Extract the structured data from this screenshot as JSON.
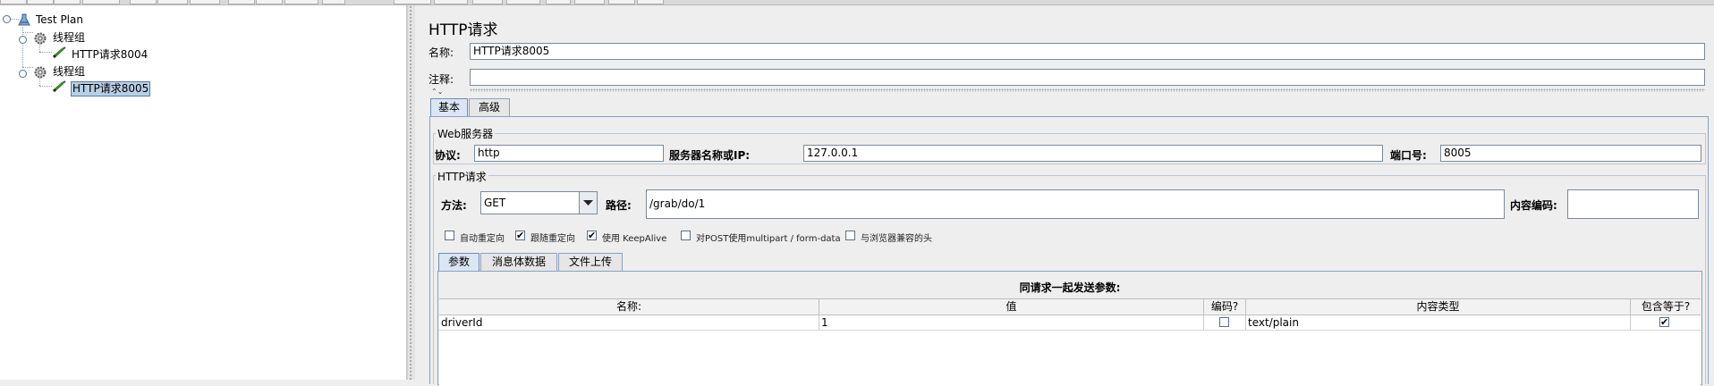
{
  "tree": {
    "items": [
      {
        "label": "Test Plan",
        "icon": "test-plan-icon"
      },
      {
        "label": "线程组",
        "icon": "thread-group-gear-icon"
      },
      {
        "label": "HTTP请求8004",
        "icon": "sampler-pipette-icon"
      },
      {
        "label": "线程组",
        "icon": "thread-group-gear-icon"
      },
      {
        "label": "HTTP请求8005",
        "icon": "sampler-pipette-icon",
        "selected": true
      }
    ]
  },
  "panel": {
    "title": "HTTP请求",
    "name_label": "名称:",
    "name_value": "HTTP请求8005",
    "comment_label": "注释:",
    "comment_value": ""
  },
  "tabs": {
    "basic": "基本",
    "advanced": "高级"
  },
  "web_server": {
    "group_title": "Web服务器",
    "protocol_label": "协议:",
    "protocol_value": "http",
    "server_label": "服务器名称或IP:",
    "server_value": "127.0.0.1",
    "port_label": "端口号:",
    "port_value": "8005"
  },
  "http_request": {
    "group_title": "HTTP请求",
    "method_label": "方法:",
    "method_value": "GET",
    "path_label": "路径:",
    "path_value": "/grab/do/1",
    "encoding_label": "内容编码:",
    "encoding_value": ""
  },
  "options": [
    {
      "label": "自动重定向",
      "checked": false
    },
    {
      "label": "跟随重定向",
      "checked": true
    },
    {
      "label": "使用 KeepAlive",
      "checked": true
    },
    {
      "label": "对POST使用multipart / form-data",
      "checked": false
    },
    {
      "label": "与浏览器兼容的头",
      "checked": false
    }
  ],
  "sub_tabs": {
    "params": "参数",
    "body": "消息体数据",
    "files": "文件上传"
  },
  "params_table": {
    "caption": "同请求一起发送参数:",
    "headers": [
      "名称:",
      "值",
      "编码?",
      "内容类型",
      "包含等于?"
    ],
    "rows": [
      {
        "name": "driverId",
        "value": "1",
        "encode": false,
        "content_type": "text/plain",
        "include_equals": true
      }
    ]
  },
  "colors": {
    "selection_bg": "#b8cfe5",
    "tab_active": "#dbe6f4",
    "border": "#7a8a99"
  }
}
